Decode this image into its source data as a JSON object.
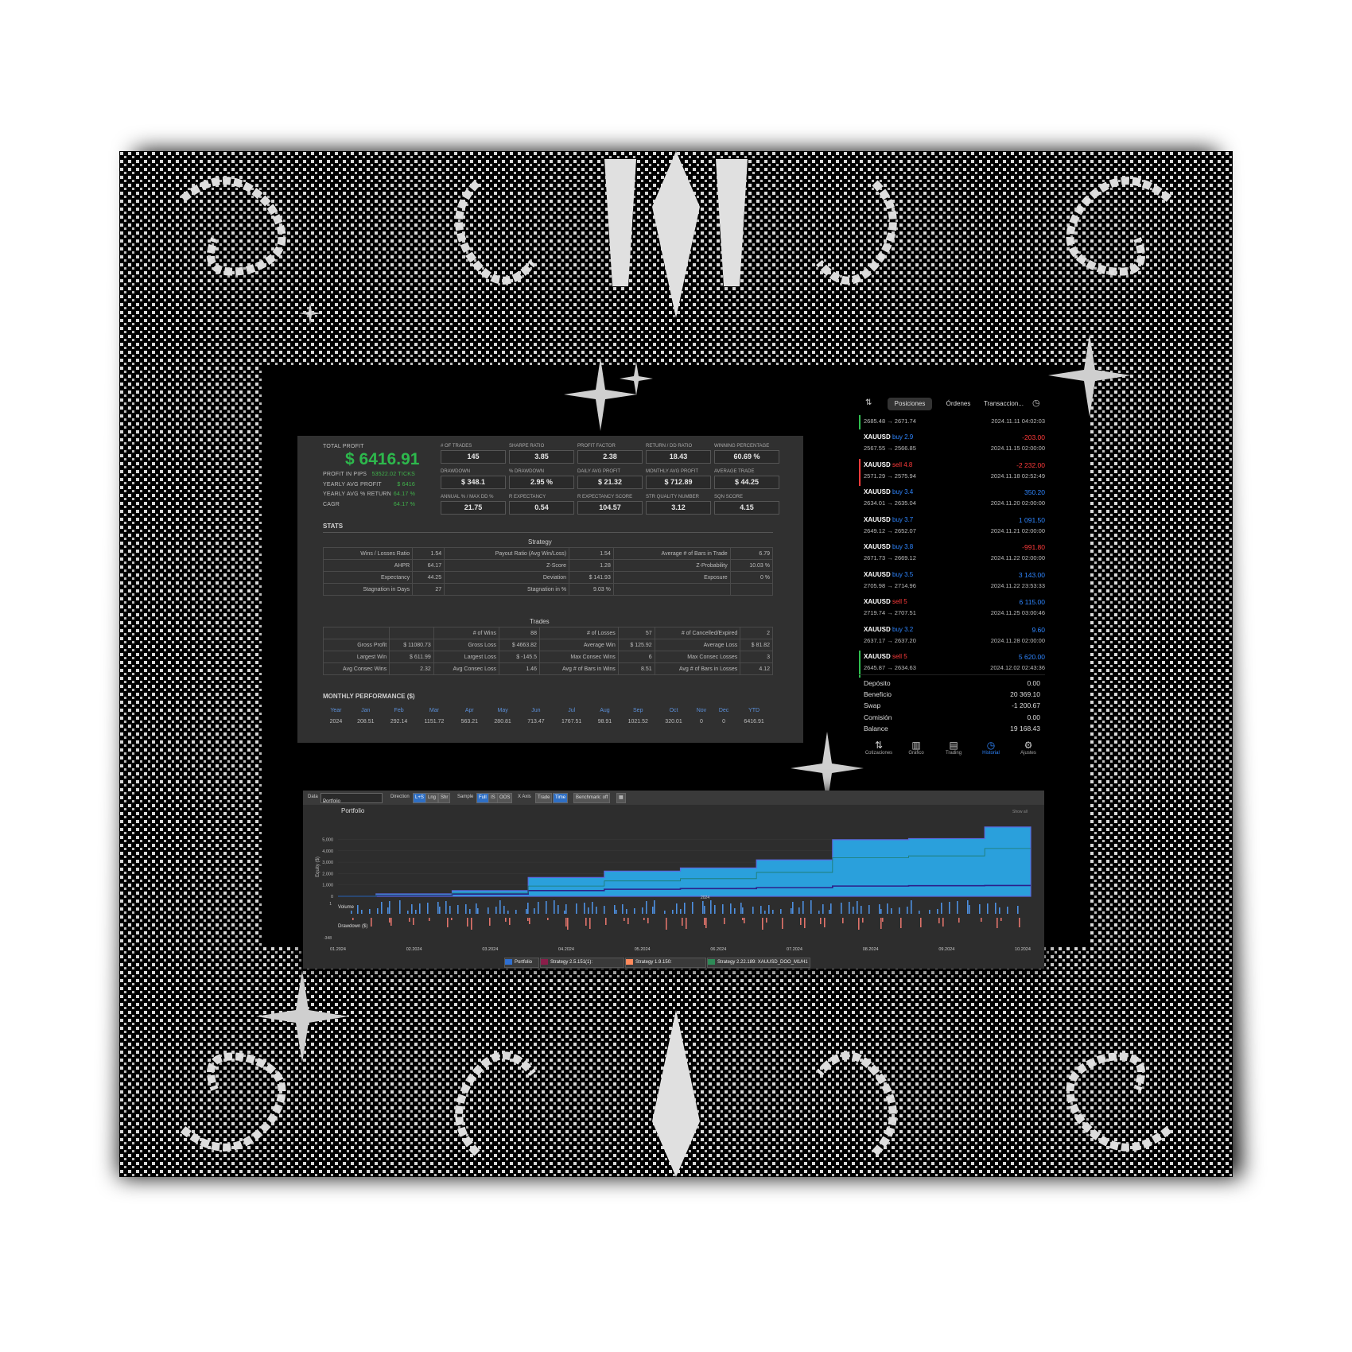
{
  "stats_panel": {
    "total_profit_label": "TOTAL PROFIT",
    "total_profit_value": "$ 6416.91",
    "side_stats": [
      {
        "label": "PROFIT IN PIPS",
        "value": "53522.02 TICKS"
      },
      {
        "label": "YEARLY AVG PROFIT",
        "value": "$ 6416"
      },
      {
        "label": "YEARLY AVG % RETURN",
        "value": "64.17 %"
      },
      {
        "label": "CAGR",
        "value": "64.17 %"
      }
    ],
    "kpis": [
      {
        "label": "# OF TRADES",
        "value": "145"
      },
      {
        "label": "SHARPE RATIO",
        "value": "3.85"
      },
      {
        "label": "PROFIT FACTOR",
        "value": "2.38"
      },
      {
        "label": "RETURN / DD RATIO",
        "value": "18.43"
      },
      {
        "label": "WINNING PERCENTAGE",
        "value": "60.69 %"
      },
      {
        "label": "DRAWDOWN",
        "value": "$ 348.1"
      },
      {
        "label": "% DRAWDOWN",
        "value": "2.95 %"
      },
      {
        "label": "DAILY AVG PROFIT",
        "value": "$ 21.32"
      },
      {
        "label": "MONTHLY AVG PROFIT",
        "value": "$ 712.89"
      },
      {
        "label": "AVERAGE TRADE",
        "value": "$ 44.25"
      },
      {
        "label": "ANNUAL % / MAX DD %",
        "value": "21.75"
      },
      {
        "label": "R EXPECTANCY",
        "value": "0.54"
      },
      {
        "label": "R EXPECTANCY SCORE",
        "value": "104.57"
      },
      {
        "label": "STR QUALITY NUMBER",
        "value": "3.12"
      },
      {
        "label": "SQN SCORE",
        "value": "4.15"
      }
    ],
    "stats_title": "STATS",
    "strategy_title": "Strategy",
    "strategy_rows": [
      [
        "Wins / Losses Ratio",
        "1.54",
        "Payout Ratio (Avg Win/Loss)",
        "1.54",
        "Average # of Bars in Trade",
        "6.79"
      ],
      [
        "AHPR",
        "64.17",
        "Z-Score",
        "1.28",
        "Z-Probability",
        "10.03 %"
      ],
      [
        "Expectancy",
        "44.25",
        "Deviation",
        "$ 141.93",
        "Exposure",
        "0 %"
      ],
      [
        "Stagnation in Days",
        "27",
        "Stagnation in %",
        "9.03 %",
        "",
        ""
      ]
    ],
    "trades_title": "Trades",
    "trades_rows": [
      [
        "",
        "",
        "# of Wins",
        "88",
        "# of Losses",
        "57",
        "# of Cancelled/Expired",
        "2"
      ],
      [
        "Gross Profit",
        "$ 11080.73",
        "Gross Loss",
        "$ 4663.82",
        "Average Win",
        "$ 125.92",
        "Average Loss",
        "$ 81.82"
      ],
      [
        "Largest Win",
        "$ 611.99",
        "Largest Loss",
        "$ -145.5",
        "Max Consec Wins",
        "6",
        "Max Consec Losses",
        "3"
      ],
      [
        "Avg Consec Wins",
        "2.32",
        "Avg Consec Loss",
        "1.46",
        "Avg # of Bars in Wins",
        "8.51",
        "Avg # of Bars in Losses",
        "4.12"
      ]
    ],
    "monthly_title": "MONTHLY PERFORMANCE ($)",
    "monthly_header": [
      "Year",
      "Jan",
      "Feb",
      "Mar",
      "Apr",
      "May",
      "Jun",
      "Jul",
      "Aug",
      "Sep",
      "Oct",
      "Nov",
      "Dec",
      "YTD"
    ],
    "monthly_row": [
      "2024",
      "208.51",
      "292.14",
      "1151.72",
      "563.21",
      "280.81",
      "713.47",
      "1767.51",
      "98.91",
      "1021.52",
      "320.01",
      "0",
      "0",
      "6416.91"
    ]
  },
  "phone_panel": {
    "tabs": [
      "Posiciones",
      "Órdenes",
      "Transaccion..."
    ],
    "colors": {
      "profit": "#2f86ff",
      "loss": "#ff3b3b",
      "buy": "#2f86ff",
      "sell": "#ff3b3b"
    },
    "first_row": {
      "prices": "2685.48 → 2671.74",
      "date": "2024.11.11 04:02:03"
    },
    "rows": [
      {
        "symbol": "XAUUSD",
        "side": "buy 2.9",
        "side_type": "buy",
        "pl": "-203.00",
        "pl_type": "loss",
        "prices": "2567.55 → 2566.85",
        "date": "2024.11.15 02:00:00"
      },
      {
        "symbol": "XAUUSD",
        "side": "sell 4.8",
        "side_type": "sell",
        "pl": "-2 232.00",
        "pl_type": "loss",
        "prices": "2571.29 → 2575.94",
        "date": "2024.11.18 02:52:49"
      },
      {
        "symbol": "XAUUSD",
        "side": "buy 3.4",
        "side_type": "buy",
        "pl": "350.20",
        "pl_type": "profit",
        "prices": "2634.01 → 2635.04",
        "date": "2024.11.20 02:00:00"
      },
      {
        "symbol": "XAUUSD",
        "side": "buy 3.7",
        "side_type": "buy",
        "pl": "1 091.50",
        "pl_type": "profit",
        "prices": "2649.12 → 2652.07",
        "date": "2024.11.21 02:00:00"
      },
      {
        "symbol": "XAUUSD",
        "side": "buy 3.8",
        "side_type": "buy",
        "pl": "-991.80",
        "pl_type": "loss",
        "prices": "2671.73 → 2669.12",
        "date": "2024.11.22 02:00:00"
      },
      {
        "symbol": "XAUUSD",
        "side": "buy 3.5",
        "side_type": "buy",
        "pl": "3 143.00",
        "pl_type": "profit",
        "prices": "2705.98 → 2714.96",
        "date": "2024.11.22 23:53:33"
      },
      {
        "symbol": "XAUUSD",
        "side": "sell 5",
        "side_type": "sell",
        "pl": "6 115.00",
        "pl_type": "profit",
        "prices": "2719.74 → 2707.51",
        "date": "2024.11.25 03:00:46"
      },
      {
        "symbol": "XAUUSD",
        "side": "buy 3.2",
        "side_type": "buy",
        "pl": "9.60",
        "pl_type": "profit",
        "prices": "2637.17 → 2637.20",
        "date": "2024.11.28 02:00:00"
      },
      {
        "symbol": "XAUUSD",
        "side": "sell 5",
        "side_type": "sell",
        "pl": "5 620.00",
        "pl_type": "profit",
        "prices": "2645.87 → 2634.63",
        "date": "2024.12.02 02:43:36"
      }
    ],
    "summary": [
      {
        "label": "Depósito",
        "value": "0.00"
      },
      {
        "label": "Beneficio",
        "value": "20 369.10"
      },
      {
        "label": "Swap",
        "value": "-1 200.67"
      },
      {
        "label": "Comisión",
        "value": "0.00"
      },
      {
        "label": "Balance",
        "value": "19 168.43"
      }
    ],
    "nav": [
      {
        "label": "Cotizaciones",
        "icon": "arrows-icon"
      },
      {
        "label": "Gráfico",
        "icon": "candles-icon"
      },
      {
        "label": "Trading",
        "icon": "chart-icon"
      },
      {
        "label": "Historial",
        "icon": "clock-icon",
        "active": true
      },
      {
        "label": "Ajustes",
        "icon": "gear-icon"
      }
    ]
  },
  "equity_panel": {
    "toolbar": {
      "data_label": "Data",
      "data_value": "Portfolio",
      "direction_label": "Direction",
      "direction_opts": [
        "L+S",
        "Lng",
        "Shr"
      ],
      "sample_label": "Sample",
      "sample_opts": [
        "Full",
        "IS",
        "OOS"
      ],
      "xaxis_label": "X Axis",
      "xaxis_opts": [
        "Trade",
        "Time"
      ],
      "benchmark": "Benchmark: off"
    },
    "chart_title": "Portfolio",
    "show_all": "Show all",
    "year_label": "2024",
    "volume_label": "Volume",
    "drawdown_label": "Drawdown ($)",
    "legend": [
      {
        "name": "Portfolio",
        "color": "#2f6fd0"
      },
      {
        "name": "Strategy 2.5.151(1): XAUUSD_DOO_M1/H1",
        "color": "#8b1e4a"
      },
      {
        "name": "Strategy 1.9.150: XAUUSD_DOO_M1/H1",
        "color": "#ff8a5c"
      },
      {
        "name": "Strategy 2.22.189: XAUUSD_DOO_M1/H1",
        "color": "#2e8b57"
      }
    ]
  },
  "chart_data": {
    "type": "area",
    "ylabel": "Equity ($)",
    "yticks": [
      "5,000",
      "4,000",
      "3,000",
      "2,000",
      "1,000",
      "0"
    ],
    "ylim": [
      0,
      6500
    ],
    "x": [
      "01.2024",
      "02.2024",
      "03.2024",
      "04.2024",
      "05.2024",
      "06.2024",
      "07.2024",
      "08.2024",
      "09.2024",
      "10.2024"
    ],
    "series": [
      {
        "name": "Portfolio",
        "values": [
          0,
          210,
          500,
          1650,
          2210,
          2490,
          3200,
          4970,
          5070,
          6090
        ]
      },
      {
        "name": "Strategy 2.5.151(1): XAUUSD_DOO_M1/H1",
        "values": [
          0,
          80,
          200,
          500,
          620,
          680,
          760,
          900,
          930,
          950
        ]
      },
      {
        "name": "Strategy 2.22.189: XAUUSD_DOO_M1/H1",
        "values": [
          0,
          120,
          280,
          900,
          1350,
          1550,
          2100,
          3400,
          3550,
          4200
        ]
      }
    ],
    "drawdown_ymin": "-348",
    "drawdown_ymax": "1"
  }
}
